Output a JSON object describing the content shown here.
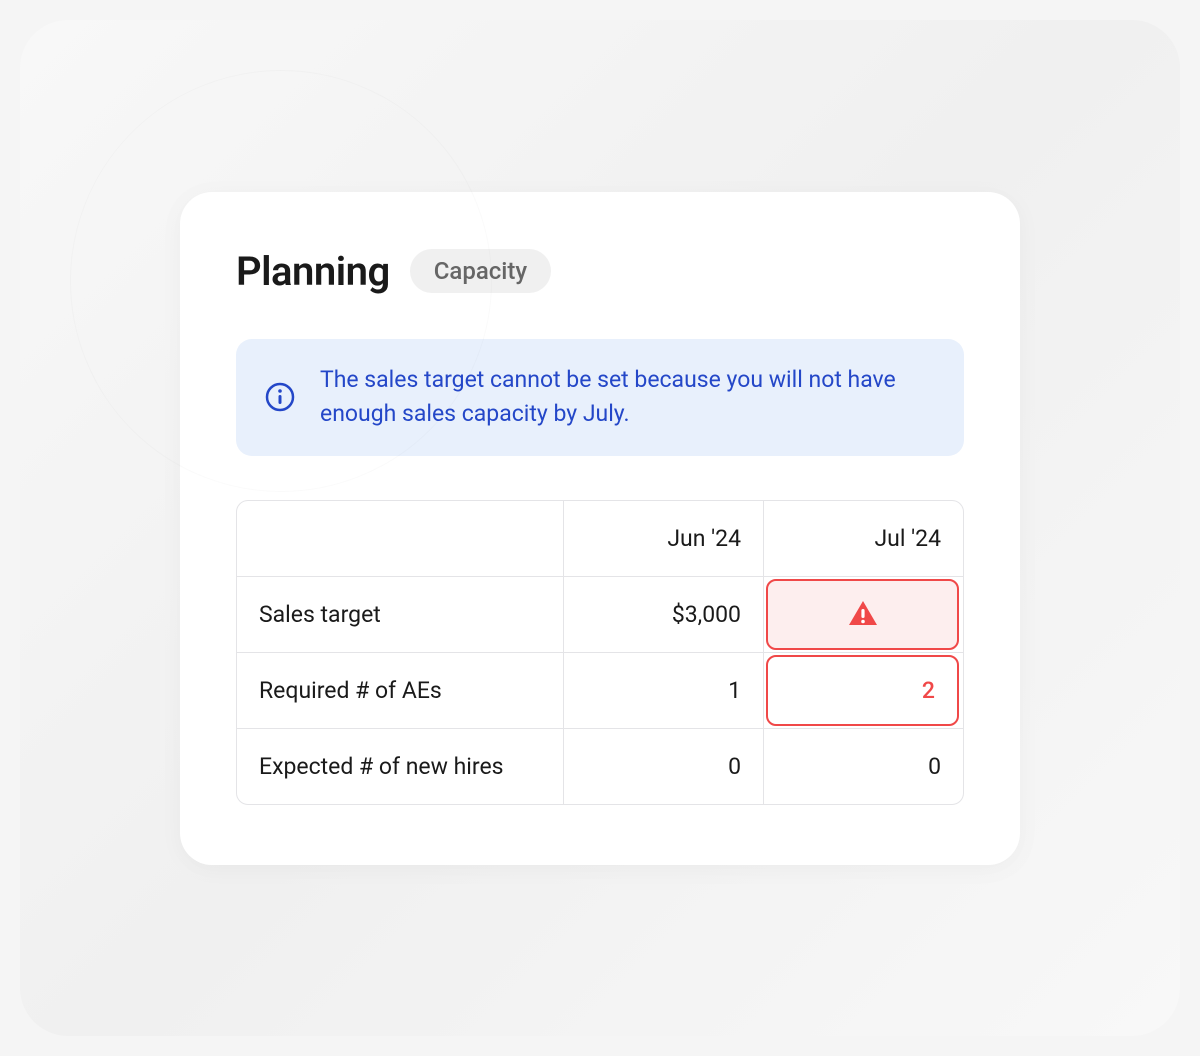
{
  "header": {
    "title": "Planning",
    "badge": "Capacity"
  },
  "alert": {
    "message": "The sales target cannot be set because you will not have enough sales capacity by July."
  },
  "table": {
    "columns": [
      "Jun '24",
      "Jul '24"
    ],
    "rows": [
      {
        "label": "Sales target",
        "values": [
          "$3,000",
          ""
        ],
        "error_col": 1,
        "error_type": "warning-icon"
      },
      {
        "label": "Required # of AEs",
        "values": [
          "1",
          "2"
        ],
        "error_col": 1,
        "error_type": "highlight-value"
      },
      {
        "label": "Expected # of new hires",
        "values": [
          "0",
          "0"
        ]
      }
    ]
  },
  "colors": {
    "error": "#f04848",
    "alert_bg": "#e8f0fc",
    "alert_text": "#2447c8"
  }
}
